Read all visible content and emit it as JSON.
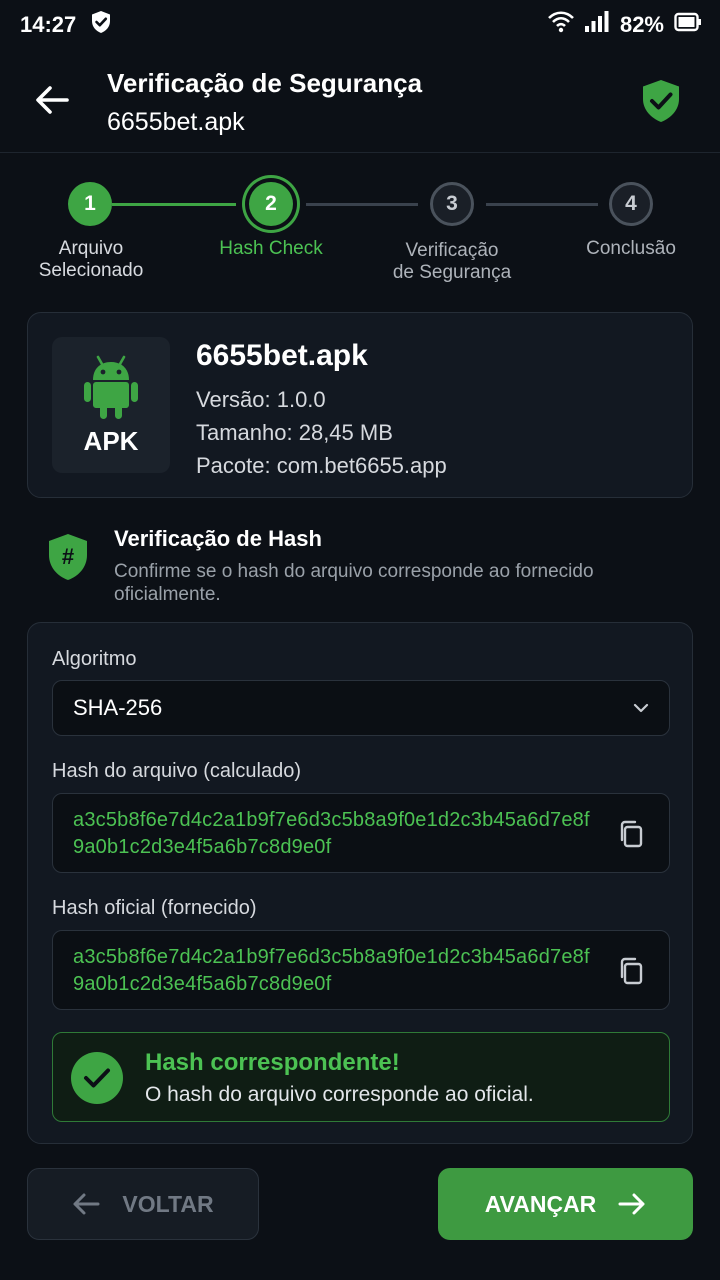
{
  "status_bar": {
    "time": "14:27",
    "battery": "82%",
    "icons": [
      "shield-status-icon",
      "wifi-icon",
      "signal-icon",
      "battery-icon"
    ]
  },
  "header": {
    "title": "Verificação de Segurança",
    "subtitle": "6655bet.apk"
  },
  "stepper": {
    "steps": [
      {
        "number": "1",
        "label": "Arquivo\nSelecionado",
        "state": "done"
      },
      {
        "number": "2",
        "label": "Hash Check",
        "state": "active"
      },
      {
        "number": "3",
        "label": "Verificação\nde Segurança",
        "state": "pending"
      },
      {
        "number": "4",
        "label": "Conclusão",
        "state": "pending"
      }
    ]
  },
  "file": {
    "badge": "APK",
    "name": "6655bet.apk",
    "version": "Versão: 1.0.0",
    "size": "Tamanho: 28,45 MB",
    "package": "Pacote: com.bet6655.app"
  },
  "hash_section": {
    "title": "Verificação de Hash",
    "description": "Confirme se o hash do arquivo corresponde ao fornecido oficialmente."
  },
  "form": {
    "algorithm_label": "Algoritmo",
    "algorithm_value": "SHA-256",
    "calculated_label": "Hash do arquivo (calculado)",
    "calculated_hash": "a3c5b8f6e7d4c2a1b9f7e6d3c5b8a9f0e1d2c3b45a6d7e8f9a0b1c2d3e4f5a6b7c8d9e0f",
    "official_label": "Hash oficial (fornecido)",
    "official_hash": "a3c5b8f6e7d4c2a1b9f7e6d3c5b8a9f0e1d2c3b45a6d7e8f9a0b1c2d3e4f5a6b7c8d9e0f"
  },
  "result": {
    "title": "Hash correspondente!",
    "description": "O hash do arquivo corresponde ao oficial."
  },
  "actions": {
    "back_label": "VOLTAR",
    "next_label": "AVANÇAR"
  },
  "colors": {
    "accent": "#3ea544",
    "accent_text": "#4cc253",
    "background": "#0c1016",
    "card": "#121821"
  }
}
